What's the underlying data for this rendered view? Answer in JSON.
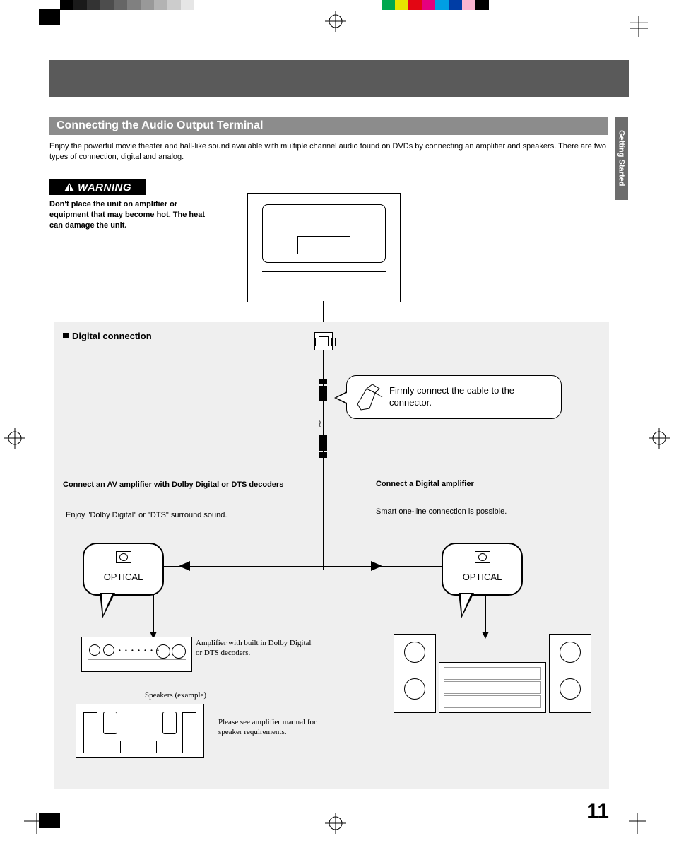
{
  "side_tab": "Getting Started",
  "section_title": "Connecting the Audio Output Terminal",
  "intro": "Enjoy the powerful movie theater and hall-like sound available with multiple channel audio found on DVDs by connecting an amplifier and speakers. There are two types of connection, digital and analog.",
  "warning": {
    "label": "WARNING",
    "text": "Don't place the unit on amplifier or equipment that may become hot. The heat can damage the unit."
  },
  "panel": {
    "title": "Digital connection",
    "callout": "Firmly connect the cable to the connector.",
    "left": {
      "heading": "Connect an AV amplifier with Dolby Digital or DTS decoders",
      "body": "Enjoy \"Dolby Digital\" or \"DTS\" surround sound.",
      "optical_label": "OPTICAL",
      "amp_caption": "Amplifier with built in Dolby Digital or DTS decoders.",
      "speakers_caption": "Speakers (example)",
      "speaker_note": "Please see amplifier manual for speaker requirements."
    },
    "right": {
      "heading": "Connect a Digital amplifier",
      "body": "Smart one-line connection is possible.",
      "optical_label": "OPTICAL"
    }
  },
  "page_number": "11"
}
